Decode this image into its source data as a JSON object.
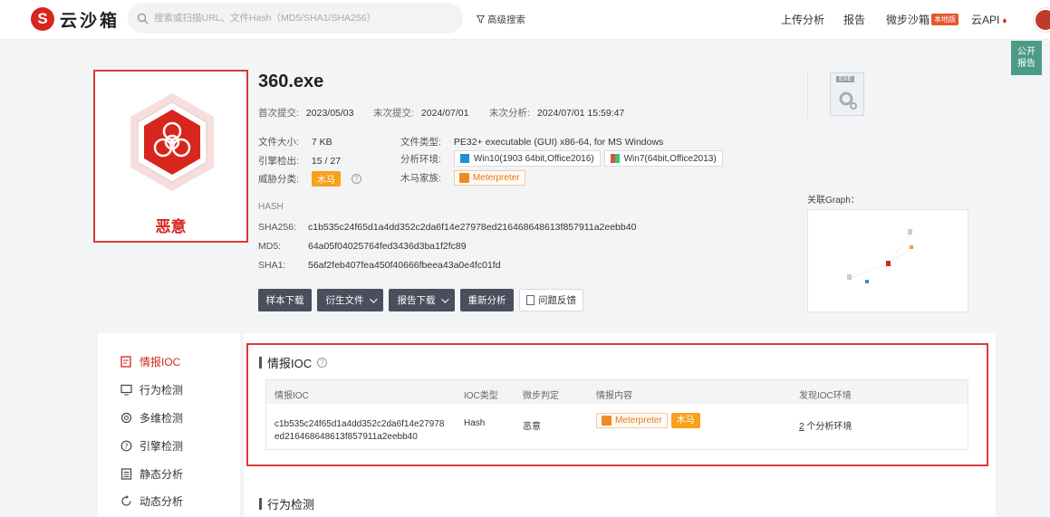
{
  "nav": {
    "logo_text": "云沙箱",
    "search_placeholder": "搜索或扫描URL、文件Hash（MD5/SHA1/SHA256）",
    "advanced_search": "高级搜索",
    "links": [
      "上传分析",
      "报告",
      "微步沙箱",
      "云API"
    ],
    "local_badge": "本地版"
  },
  "float_tab": {
    "line1": "公开",
    "line2": "报告"
  },
  "verdict": {
    "label": "恶意"
  },
  "file": {
    "name": "360.exe",
    "first_submit_label": "首次提交:",
    "first_submit": "2023/05/03",
    "last_submit_label": "末次提交:",
    "last_submit": "2024/07/01",
    "last_analysis_label": "末次分析:",
    "last_analysis": "2024/07/01 15:59:47",
    "size_label": "文件大小:",
    "size": "7 KB",
    "engine_label": "引擎检出:",
    "engine_hits": "15",
    "engine_total": "/ 27",
    "threat_label": "威胁分类:",
    "threat": "木马",
    "type_label": "文件类型:",
    "type": "PE32+ executable (GUI) x86-64, for MS Windows",
    "env_label": "分析环境:",
    "env1": "Win10(1903 64bit,Office2016)",
    "env2": "Win7(64bit,Office2013)",
    "family_label": "木马家族:",
    "family": "Meterpreter",
    "file_icon_ext": "EXE"
  },
  "hash": {
    "section_label": "HASH",
    "sha256_label": "SHA256:",
    "sha256": "c1b535c24f65d1a4dd352c2da6f14e27978ed216468648613f857911a2eebb40",
    "md5_label": "MD5:",
    "md5": "64a05f04025764fed3436d3ba1f2fc89",
    "sha1_label": "SHA1:",
    "sha1": "56af2feb407fea450f40666fbeea43a0e4fc01fd"
  },
  "actions": {
    "download_sample": "样本下载",
    "derived_files": "衍生文件",
    "report_download": "报告下载",
    "reanalyze": "重新分析",
    "feedback": "问题反馈"
  },
  "graph": {
    "label": "关联Graph："
  },
  "sidebar": {
    "items": [
      "情报IOC",
      "行为检测",
      "多维检测",
      "引擎检测",
      "静态分析",
      "动态分析"
    ]
  },
  "ioc": {
    "title": "情报IOC",
    "headers": [
      "情报IOC",
      "IOC类型",
      "微步判定",
      "情报内容",
      "发现IOC环境"
    ],
    "row": {
      "ioc_line1": "c1b535c24f65d1a4dd352c2da6f14e27978",
      "ioc_line2": "ed216468648613f857911a2eebb40",
      "type": "Hash",
      "verdict": "恶意",
      "intel_tag1": "Meterpreter",
      "intel_tag2": "木马",
      "env_count": "2",
      "env_text": "个分析环境"
    }
  },
  "behavior": {
    "title": "行为检测"
  },
  "colors": {
    "accent": "#d7261e",
    "dark_button": "#4a4f5d",
    "orange": "#f6a21b",
    "teal": "#4b9b86"
  }
}
